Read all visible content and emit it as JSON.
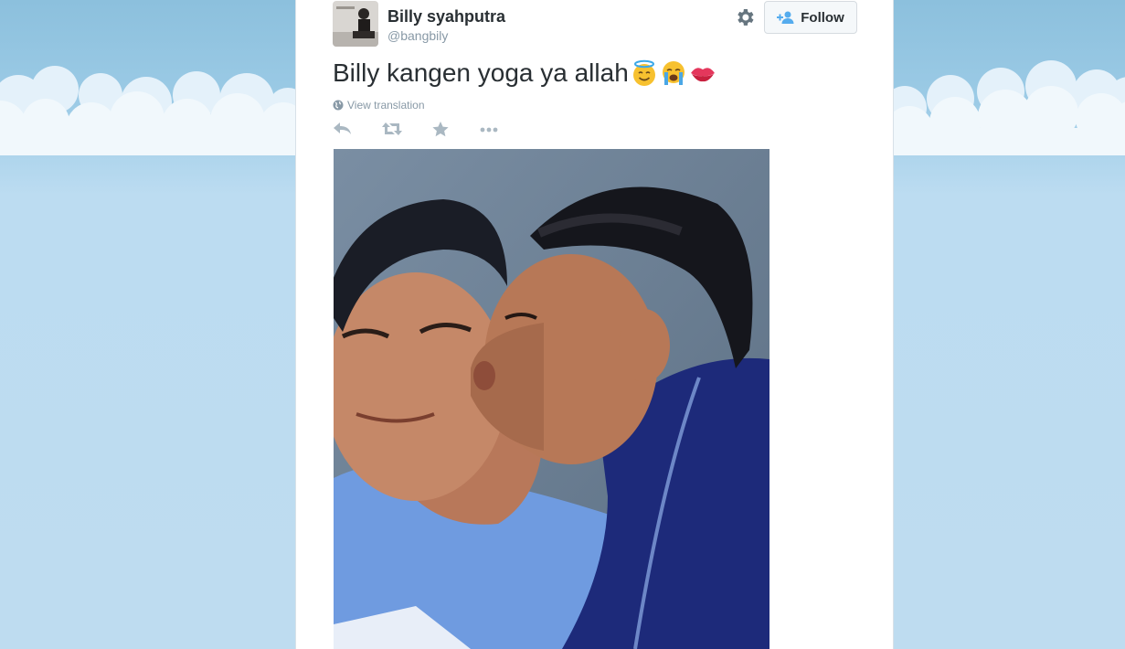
{
  "tweet": {
    "display_name": "Billy syahputra",
    "handle": "@bangbily",
    "text": "Billy kangen yoga ya allah",
    "emojis": [
      "smiling-face-with-halo",
      "loudly-crying-face",
      "kiss-mark"
    ],
    "translation_label": "View translation",
    "follow_label": "Follow",
    "actions": [
      "reply-icon",
      "retweet-icon",
      "favorite-icon",
      "more-icon"
    ]
  },
  "colors": {
    "sky": "#b9daf0",
    "text": "#292f33",
    "muted": "#8899a6",
    "accent": "#55acee"
  }
}
